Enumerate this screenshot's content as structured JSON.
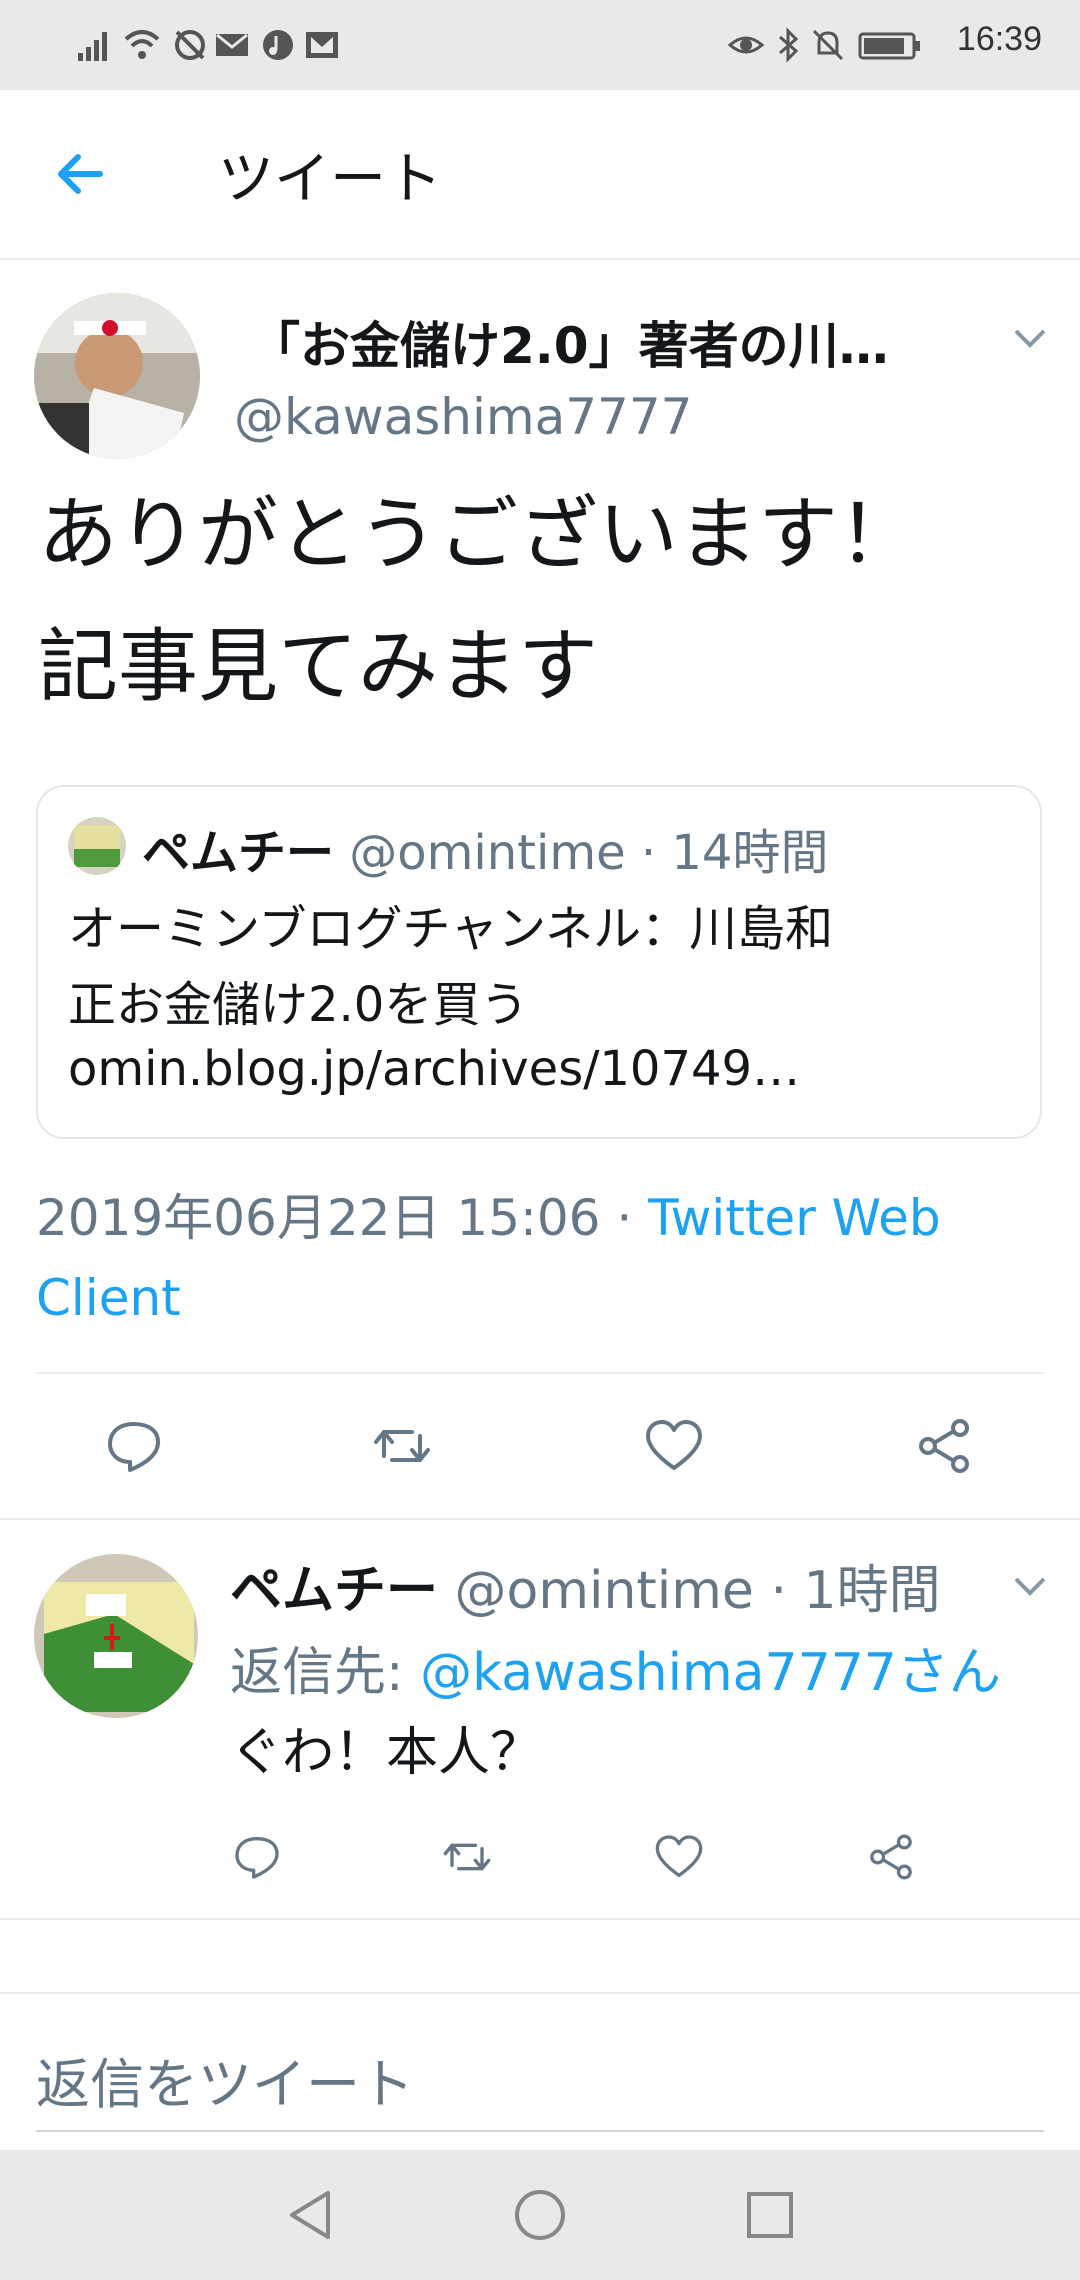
{
  "status_bar": {
    "time": "16:39"
  },
  "header": {
    "title": "ツイート",
    "back_icon": "arrow-left-icon"
  },
  "main_tweet": {
    "display_name": "「お金儲け2.0」著者の川…",
    "handle": "@kawashima7777",
    "text_line1": "ありがとうございます！",
    "text_line2": "記事見てみます",
    "quote": {
      "display_name": "ペムチー",
      "handle": "@omintime",
      "time": "· 14時間",
      "line1": "オーミンブログチャンネル：川島和",
      "line2": "正お金儲け2.0を買う",
      "line3": "omin.blog.jp/archives/10749…"
    },
    "timestamp": "2019年06月22日 15:06 · ",
    "client": "Twitter Web Client"
  },
  "reply_tweet": {
    "display_name": "ペムチー",
    "handle": "@omintime",
    "time": "· 1時間",
    "reply_prefix": "返信先: ",
    "reply_target": "@kawashima7777さん",
    "text": "ぐわ！本人？"
  },
  "composer": {
    "placeholder": "返信をツイート"
  },
  "colors": {
    "accent": "#1da1f2",
    "secondary_text": "#657786",
    "primary_text": "#14171a",
    "system_bar": "#e9e9e9"
  }
}
